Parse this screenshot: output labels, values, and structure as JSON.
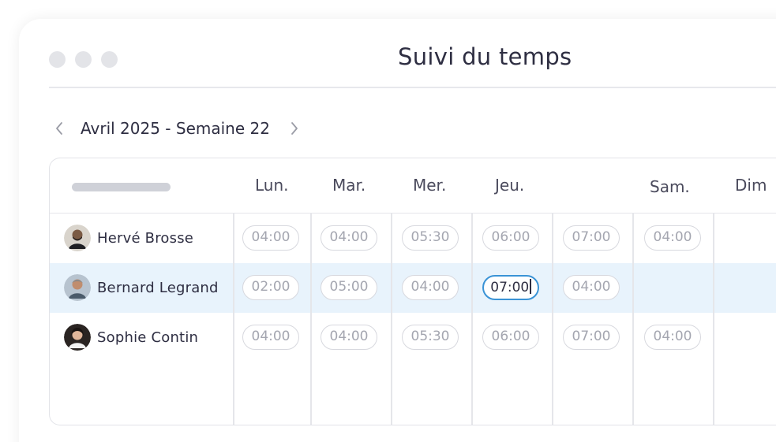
{
  "window": {
    "title": "Suivi du temps"
  },
  "nav": {
    "week_label": "Avril 2025 - Semaine 22"
  },
  "days": [
    "Lun.",
    "Mar.",
    "Mer.",
    "Jeu.",
    "",
    "Sam.",
    "Dim"
  ],
  "colors": {
    "accent": "#3a93d6",
    "highlight_row": "#e8f3fc",
    "cell_border": "#d7d8de",
    "cell_text": "#a4a6b0"
  },
  "rows": [
    {
      "name": "Hervé Brosse",
      "avatar_icon": "person-avatar-icon",
      "hours": [
        "04:00",
        "04:00",
        "05:30",
        "06:00",
        "07:00",
        "04:00",
        ""
      ]
    },
    {
      "name": "Bernard Legrand",
      "avatar_icon": "person-avatar-icon",
      "hours": [
        "02:00",
        "05:00",
        "04:00",
        "07:00",
        "04:00",
        "",
        ""
      ],
      "selected": true,
      "editing_index": 3
    },
    {
      "name": "Sophie Contin",
      "avatar_icon": "person-avatar-icon",
      "hours": [
        "04:00",
        "04:00",
        "05:30",
        "06:00",
        "07:00",
        "04:00",
        ""
      ]
    }
  ]
}
